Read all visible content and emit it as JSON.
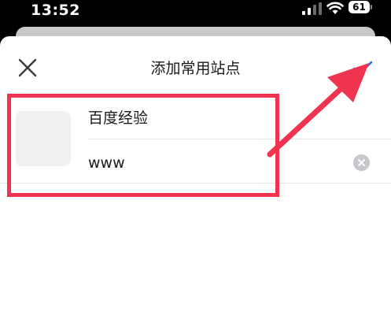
{
  "status_bar": {
    "time": "13:52",
    "battery": "61"
  },
  "modal": {
    "title": "添加常用站点",
    "close_icon": "close-icon",
    "confirm_icon": "checkmark-icon"
  },
  "form": {
    "name_value": "百度经验",
    "url_value": "www",
    "clear_icon": "clear-icon"
  },
  "annotation": {
    "color": "#f0344f"
  },
  "colors": {
    "accent": "#2b6cf0",
    "annotation": "#f0344f"
  }
}
